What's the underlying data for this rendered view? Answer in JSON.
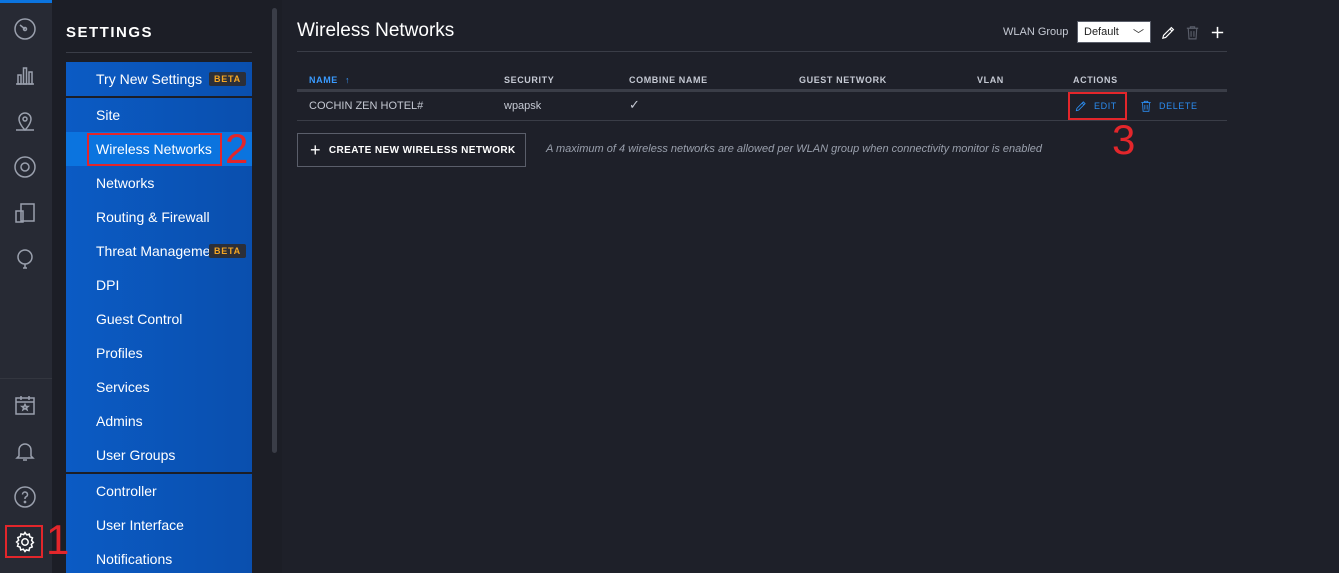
{
  "rail": {
    "icons": [
      "dashboard-icon",
      "statistics-icon",
      "map-icon",
      "devices-icon",
      "clients-icon",
      "insights-icon",
      "events-icon",
      "alerts-icon",
      "help-icon",
      "settings-icon"
    ]
  },
  "settings": {
    "title": "SETTINGS",
    "groups": [
      [
        {
          "label": "Try New Settings",
          "badge": "BETA"
        }
      ],
      [
        {
          "label": "Site"
        },
        {
          "label": "Wireless Networks",
          "active": true
        },
        {
          "label": "Networks"
        },
        {
          "label": "Routing & Firewall"
        },
        {
          "label": "Threat Management",
          "badge": "BETA"
        },
        {
          "label": "DPI"
        },
        {
          "label": "Guest Control"
        },
        {
          "label": "Profiles"
        },
        {
          "label": "Services"
        },
        {
          "label": "Admins"
        },
        {
          "label": "User Groups"
        }
      ],
      [
        {
          "label": "Controller"
        },
        {
          "label": "User Interface"
        },
        {
          "label": "Notifications"
        }
      ]
    ]
  },
  "main": {
    "title": "Wireless Networks",
    "wlan_group_label": "WLAN Group",
    "wlan_group_value": "Default",
    "table": {
      "columns": [
        "NAME",
        "SECURITY",
        "COMBINE NAME",
        "GUEST NETWORK",
        "VLAN",
        "ACTIONS"
      ],
      "sort_indicator": "↑",
      "rows": [
        {
          "name": "COCHIN ZEN HOTEL#",
          "security": "wpapsk",
          "combine_name": "✓",
          "guest_network": "",
          "vlan": ""
        }
      ],
      "edit_label": "EDIT",
      "delete_label": "DELETE"
    },
    "create_button": "CREATE NEW WIRELESS NETWORK",
    "note": "A maximum of 4 wireless networks are allowed per WLAN group when connectivity monitor is enabled"
  },
  "annotations": [
    "1",
    "2",
    "3"
  ],
  "colors": {
    "accent": "#0b74df",
    "nav_bg": "#0b5bc4",
    "annotation": "#e3262b",
    "badge_text": "#f5a623"
  }
}
